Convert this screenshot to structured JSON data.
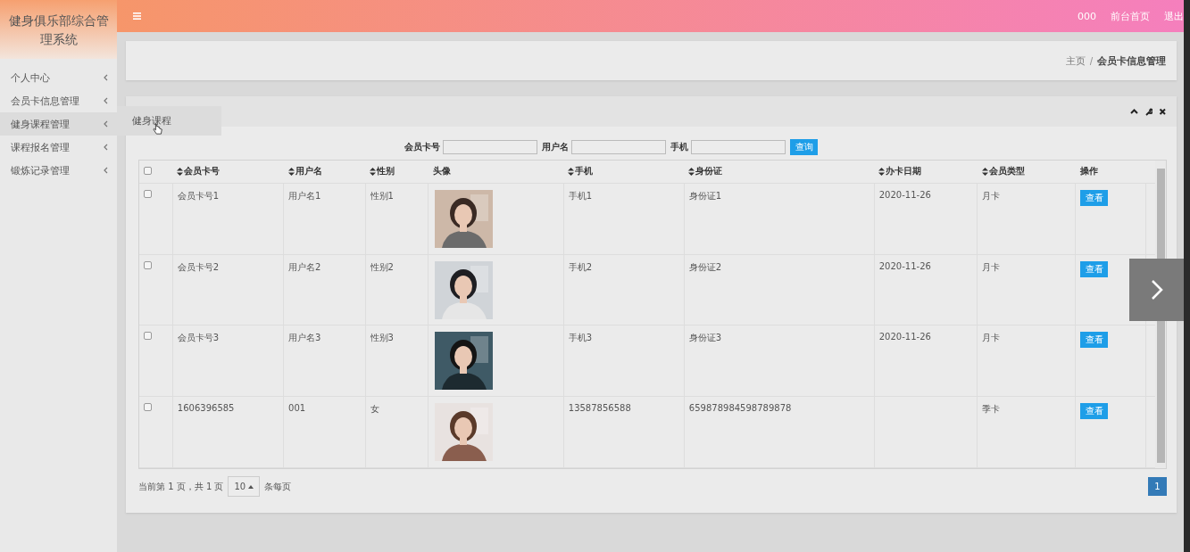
{
  "sidebar": {
    "title": "健身俱乐部综合管理系统",
    "items": [
      {
        "label": "个人中心",
        "selected": false
      },
      {
        "label": "会员卡信息管理",
        "selected": false
      },
      {
        "label": "健身课程管理",
        "selected": true,
        "submenu": [
          {
            "label": "健身课程"
          }
        ]
      },
      {
        "label": "课程报名管理",
        "selected": false
      },
      {
        "label": "锻炼记录管理",
        "selected": false
      }
    ]
  },
  "topbar": {
    "links": [
      "000",
      "前台首页",
      "退出"
    ]
  },
  "breadcrumb": [
    "主页",
    "会员卡信息管理"
  ],
  "search": {
    "fields": [
      {
        "label": "会员卡号"
      },
      {
        "label": "用户名"
      },
      {
        "label": "手机"
      }
    ],
    "button": "查询"
  },
  "table": {
    "select_all_checked": false,
    "columns": [
      {
        "label": "会员卡号",
        "sortable": true
      },
      {
        "label": "用户名",
        "sortable": true
      },
      {
        "label": "性别",
        "sortable": true
      },
      {
        "label": "头像",
        "sortable": false
      },
      {
        "label": "手机",
        "sortable": true
      },
      {
        "label": "身份证",
        "sortable": true
      },
      {
        "label": "办卡日期",
        "sortable": true
      },
      {
        "label": "会员类型",
        "sortable": true
      },
      {
        "label": "操作",
        "sortable": false
      }
    ],
    "rows": [
      {
        "checked": false,
        "cells": [
          "会员卡号1",
          "用户名1",
          "性别1",
          {
            "kind": "picture"
          },
          "手机1",
          "身份证1",
          "2020-11-26",
          "月卡"
        ],
        "action": "查看"
      },
      {
        "checked": false,
        "cells": [
          "会员卡号2",
          "用户名2",
          "性别2",
          {
            "kind": "picture"
          },
          "手机2",
          "身份证2",
          "2020-11-26",
          "月卡"
        ],
        "action": "查看"
      },
      {
        "checked": false,
        "cells": [
          "会员卡号3",
          "用户名3",
          "性别3",
          {
            "kind": "picture"
          },
          "手机3",
          "身份证3",
          "2020-11-26",
          "月卡"
        ],
        "action": "查看"
      },
      {
        "checked": false,
        "cells": [
          "1606396585",
          "001",
          "女",
          {
            "kind": "picture"
          },
          "13587856588",
          "659878984598789878",
          "",
          "季卡"
        ],
        "action": "查看"
      }
    ]
  },
  "pagination": {
    "summary": "当前第 1 页，共 1 页",
    "page_size": "10",
    "per_page": "条每页",
    "pages": [
      {
        "label": "1",
        "selected": true
      }
    ]
  }
}
